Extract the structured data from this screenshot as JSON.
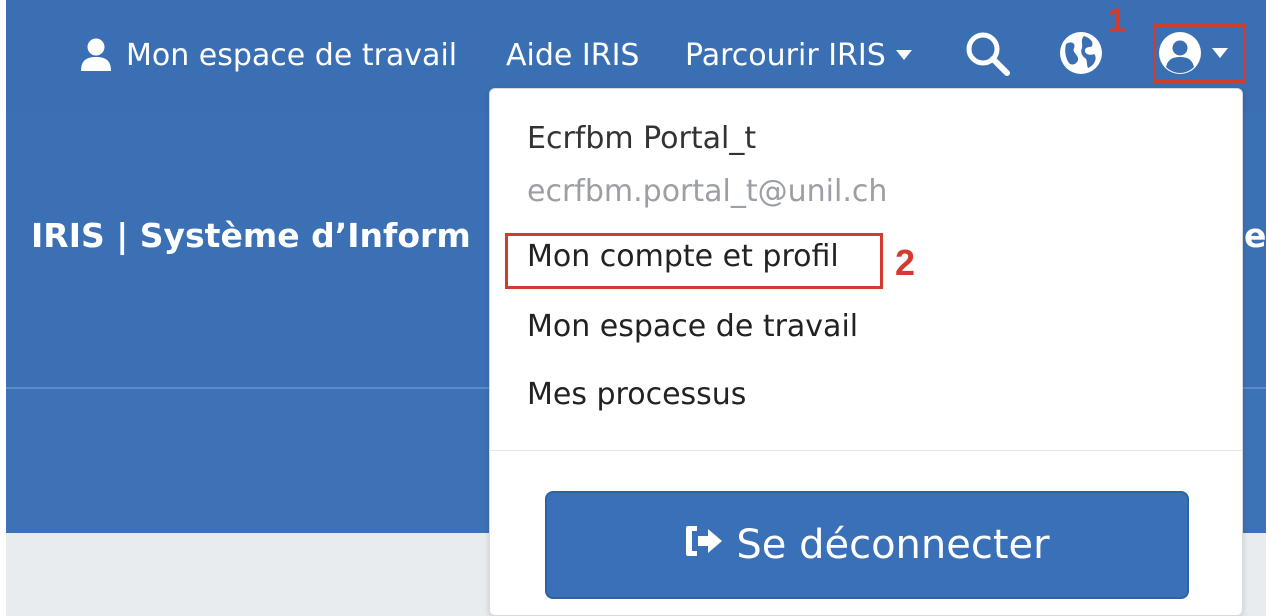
{
  "nav": {
    "workspace_label": "Mon espace de travail",
    "help_label": "Aide IRIS",
    "browse_label": "Parcourir IRIS",
    "search_icon": "search-icon",
    "language_icon": "globe-icon",
    "user_icon": "user-circle-icon"
  },
  "banner": {
    "title": "IRIS | Système d’Inform",
    "title_right_fragment": "e"
  },
  "dropdown": {
    "user_name": "Ecrfbm Portal_t",
    "user_email": "ecrfbm.portal_t@unil.ch",
    "items": [
      {
        "label": "Mon compte et profil"
      },
      {
        "label": "Mon espace de travail"
      },
      {
        "label": "Mes processus"
      }
    ],
    "logout_label": "Se déconnecter"
  },
  "annotations": {
    "step1": "1",
    "step2": "2"
  },
  "colors": {
    "header_blue": "#3a6fb3",
    "button_blue": "#3a70b7",
    "annotation_red": "#d23b2f",
    "muted_text": "#9aa0a6"
  }
}
